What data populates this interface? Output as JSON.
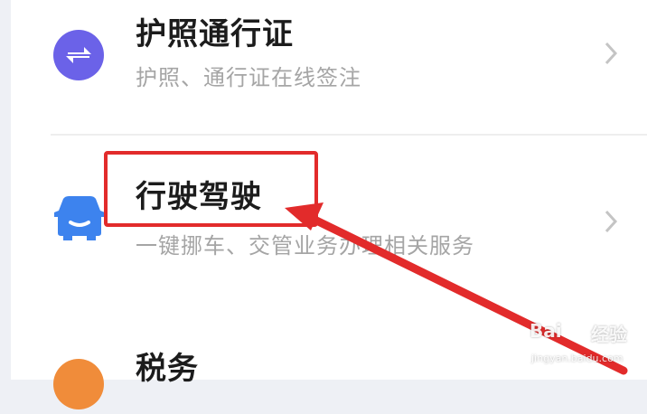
{
  "services": [
    {
      "title": "护照通行证",
      "subtitle": "护照、通行证在线签注",
      "icon": "exchange-arrows-icon",
      "icon_color": "#6b62e8"
    },
    {
      "title": "行驶驾驶",
      "subtitle": "一键挪车、交管业务办理相关服务",
      "icon": "car-icon",
      "icon_color": "#3d83ee"
    },
    {
      "title": "税务",
      "subtitle": "",
      "icon": "tax-icon",
      "icon_color": "#f08c3a"
    }
  ],
  "annotation": {
    "color": "#e22b2b"
  },
  "watermark": {
    "brand": "Bai",
    "brand_cn": "经验",
    "url": "jingyan.baidu.com"
  }
}
